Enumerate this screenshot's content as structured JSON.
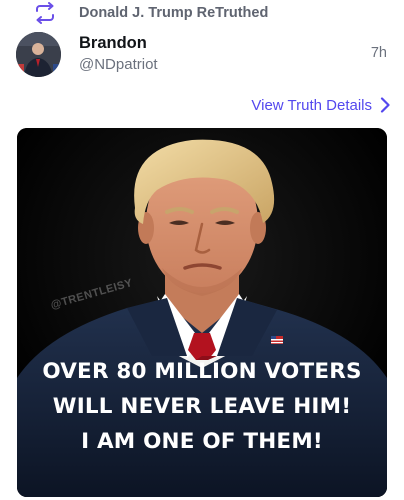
{
  "retruth": {
    "icon": "retruth-icon",
    "text": "Donald J. Trump ReTruthed"
  },
  "post": {
    "avatar_icon": "avatar",
    "display_name": "Brandon",
    "handle": "@NDpatriot",
    "timestamp": "7h",
    "details_link": "View Truth Details",
    "details_icon": "chevron-right-icon",
    "image": {
      "watermark": "@TRENTLEISY",
      "caption_lines": [
        "OVER 80 MILLION VOTERS",
        "WILL NEVER LEAVE HIM!",
        "I AM ONE OF THEM!"
      ]
    }
  },
  "colors": {
    "accent": "#5448ee",
    "muted_text": "#6b717d",
    "image_background": "#000000"
  }
}
